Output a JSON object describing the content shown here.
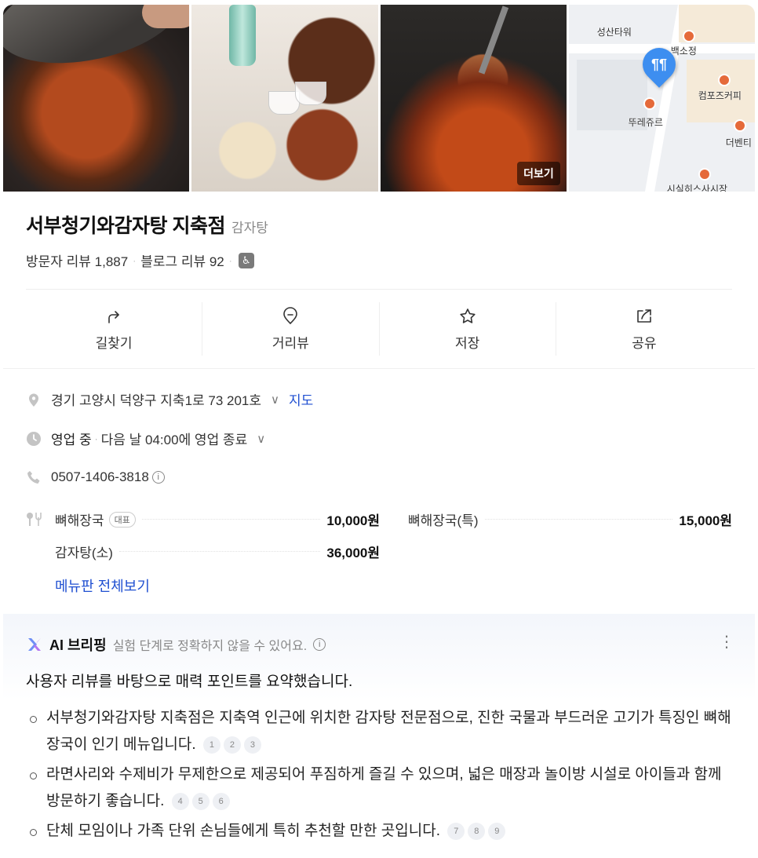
{
  "gallery": {
    "more_label": "더보기",
    "map_labels": [
      "성산타워",
      "백소정",
      "컴포즈커피",
      "뚜레쥬르",
      "더벤티",
      "시실히스사시장"
    ],
    "map_pin_glyph": "¶¶"
  },
  "place": {
    "name": "서부청기와감자탕 지축점",
    "category": "감자탕",
    "visitor_reviews": "방문자 리뷰 1,887",
    "blog_reviews": "블로그 리뷰 92",
    "separator": "·"
  },
  "actions": [
    {
      "label": "길찾기",
      "icon": "directions-icon"
    },
    {
      "label": "거리뷰",
      "icon": "street-view-icon"
    },
    {
      "label": "저장",
      "icon": "star-icon"
    },
    {
      "label": "공유",
      "icon": "share-icon"
    }
  ],
  "info": {
    "address": "경기 고양시 덕양구 지축1로 73 201호",
    "map_link": "지도",
    "hours_status": "영업 중",
    "hours_detail": "다음 날 04:00에 영업 종료",
    "phone": "0507-1406-3818",
    "chevron": "∨",
    "info_glyph": "i"
  },
  "menu": {
    "items": [
      {
        "name": "뼈해장국",
        "badge": "대표",
        "price": "10,000원"
      },
      {
        "name": "뼈해장국(특)",
        "price": "15,000원"
      },
      {
        "name": "감자탕(소)",
        "price": "36,000원"
      }
    ],
    "view_all": "메뉴판 전체보기"
  },
  "ai": {
    "title": "AI 브리핑",
    "note": "실험 단계로 정확하지 않을 수 있어요.",
    "summary": "사용자 리뷰를 바탕으로 매력 포인트를 요약했습니다.",
    "points": [
      {
        "text": "서부청기와감자탕 지축점은 지축역 인근에 위치한 감자탕 전문점으로, 진한 국물과 부드러운 고기가 특징인 뼈해장국이 인기 메뉴입니다.",
        "cites": [
          "1",
          "2",
          "3"
        ]
      },
      {
        "text": "라면사리와 수제비가 무제한으로 제공되어 푸짐하게 즐길 수 있으며, 넓은 매장과 놀이방 시설로 아이들과 함께 방문하기 좋습니다.",
        "cites": [
          "4",
          "5",
          "6"
        ]
      },
      {
        "text": "단체 모임이나 가족 단위 손님들에게 특히 추천할 만한 곳입니다.",
        "cites": [
          "7",
          "8",
          "9"
        ]
      }
    ],
    "kebab": "⋮"
  },
  "colors": {
    "link": "#1f4fd1",
    "pin": "#3d8ef0"
  }
}
